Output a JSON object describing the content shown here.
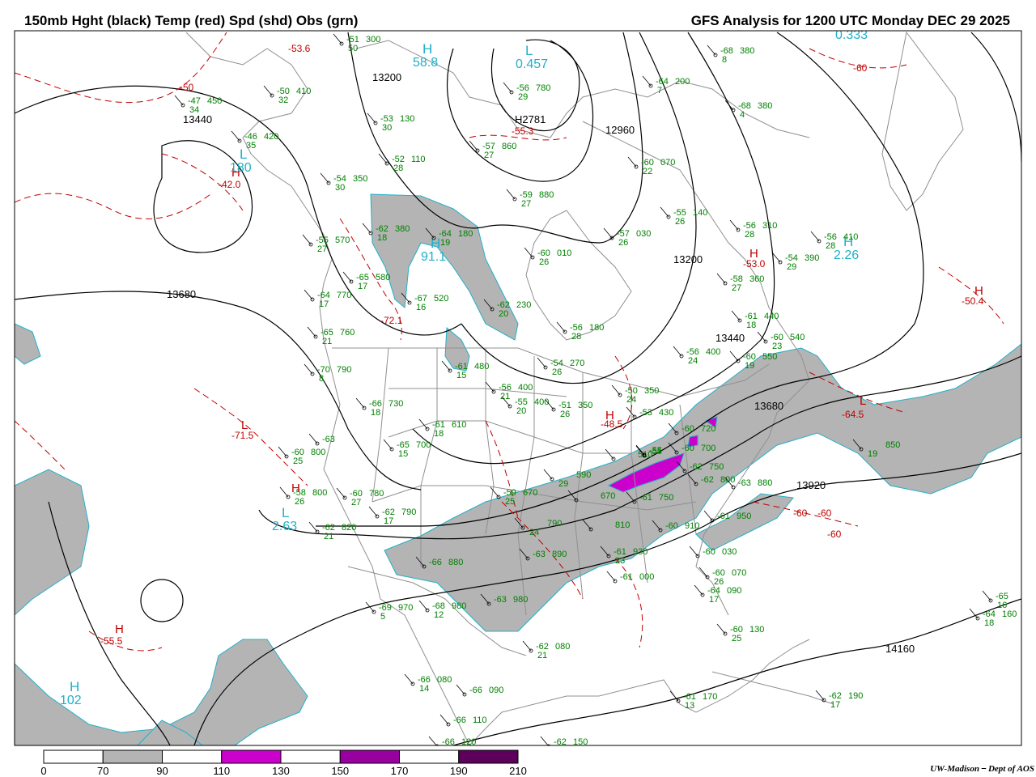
{
  "header": {
    "left_title": "150mb Hght (black) Temp (red) Spd (shd) Obs (grn)",
    "right_title": "GFS Analysis for 1200 UTC Monday  DEC 29 2025"
  },
  "colors": {
    "height": "#000000",
    "temperature": "#c00000",
    "observations": "#008000",
    "speed_70_90": "#b4b4b4",
    "speed_110_130": "#cc00cc",
    "speed_150_170": "#9900a0",
    "speed_190_210": "#5c005c",
    "pressure_centers": "#20b0c8",
    "borders": "#909090"
  },
  "colorbar": {
    "labels": [
      "0",
      "70",
      "90",
      "110",
      "130",
      "150",
      "170",
      "190",
      "210"
    ],
    "segments": [
      {
        "from": 0,
        "to": 70,
        "color": "#ffffff"
      },
      {
        "from": 70,
        "to": 90,
        "color": "#b4b4b4"
      },
      {
        "from": 90,
        "to": 110,
        "color": "#ffffff"
      },
      {
        "from": 110,
        "to": 130,
        "color": "#cc00cc"
      },
      {
        "from": 130,
        "to": 150,
        "color": "#ffffff"
      },
      {
        "from": 150,
        "to": 170,
        "color": "#9900a0"
      },
      {
        "from": 170,
        "to": 190,
        "color": "#ffffff"
      },
      {
        "from": 190,
        "to": 210,
        "color": "#5c005c"
      }
    ]
  },
  "height_labels": [
    "13200",
    "13440",
    "13680",
    "12960",
    "13200",
    "13440",
    "13680",
    "13920",
    "14160",
    "H2781"
  ],
  "temperature_labels": [
    "-53.6",
    "-50",
    "-60",
    "-42.0",
    "-55.3",
    "-72.1",
    "-71.5",
    "-48.5",
    "-60",
    "-53.0",
    "-50.4",
    "-64.5",
    "-60",
    "-60",
    "-55.5"
  ],
  "pressure_centers": [
    {
      "letter": "H",
      "value": "58.8"
    },
    {
      "letter": "L",
      "value": "180"
    },
    {
      "letter": "H",
      "value": "91.1"
    },
    {
      "letter": "L",
      "value": "2.63"
    },
    {
      "letter": "H",
      "value": "102"
    },
    {
      "letter": "H",
      "value": "2.26"
    },
    {
      "letter": "L",
      "value": "0.457"
    },
    {
      "letter": "",
      "value": "0.333"
    }
  ],
  "observations": [
    {
      "temp": "-51",
      "hgt": "300",
      "spd": "50"
    },
    {
      "temp": "-47",
      "hgt": "450",
      "spd": "34"
    },
    {
      "temp": "-50",
      "hgt": "410",
      "spd": "32"
    },
    {
      "temp": "-46",
      "hgt": "420",
      "spd": "35"
    },
    {
      "temp": "-53",
      "hgt": "130",
      "spd": "30"
    },
    {
      "temp": "-57",
      "hgt": "860",
      "spd": "27"
    },
    {
      "temp": "-56",
      "hgt": "780",
      "spd": "29"
    },
    {
      "temp": "-52",
      "hgt": "110",
      "spd": "28"
    },
    {
      "temp": "-54",
      "hgt": "350",
      "spd": "30"
    },
    {
      "temp": "-59",
      "hgt": "880",
      "spd": "27"
    },
    {
      "temp": "-64",
      "hgt": "200",
      "spd": "7"
    },
    {
      "temp": "-68",
      "hgt": "380",
      "spd": "8"
    },
    {
      "temp": "-68",
      "hgt": "380",
      "spd": "4"
    },
    {
      "temp": "-60",
      "hgt": "070",
      "spd": "22"
    },
    {
      "temp": "-55",
      "hgt": "570",
      "spd": "27"
    },
    {
      "temp": "-62",
      "hgt": "380",
      "spd": "18"
    },
    {
      "temp": "-64",
      "hgt": "180",
      "spd": "19"
    },
    {
      "temp": "-60",
      "hgt": "010",
      "spd": "26"
    },
    {
      "temp": "-57",
      "hgt": "030",
      "spd": "26"
    },
    {
      "temp": "-55",
      "hgt": "140",
      "spd": "26"
    },
    {
      "temp": "-56",
      "hgt": "310",
      "spd": "28"
    },
    {
      "temp": "-54",
      "hgt": "390",
      "spd": "29"
    },
    {
      "temp": "-56",
      "hgt": "410",
      "spd": "28"
    },
    {
      "temp": "-65",
      "hgt": "580",
      "spd": "17"
    },
    {
      "temp": "-67",
      "hgt": "520",
      "spd": "16"
    },
    {
      "temp": "-62",
      "hgt": "230",
      "spd": "20"
    },
    {
      "temp": "-58",
      "hgt": "360",
      "spd": "27"
    },
    {
      "temp": "-61",
      "hgt": "440",
      "spd": "18"
    },
    {
      "temp": "-56",
      "hgt": "180",
      "spd": "28"
    },
    {
      "temp": "-65",
      "hgt": "760",
      "spd": "21"
    },
    {
      "temp": "-70",
      "hgt": "790",
      "spd": "8"
    },
    {
      "temp": "-64",
      "hgt": "770",
      "spd": "17"
    },
    {
      "temp": "-60",
      "hgt": "540",
      "spd": "23"
    },
    {
      "temp": "-56",
      "hgt": "400",
      "spd": "24"
    },
    {
      "temp": "-60",
      "hgt": "550",
      "spd": "19"
    },
    {
      "temp": "-61",
      "hgt": "480",
      "spd": "15"
    },
    {
      "temp": "-54",
      "hgt": "270",
      "spd": "26"
    },
    {
      "temp": "-56",
      "hgt": "400",
      "spd": "21"
    },
    {
      "temp": "-55",
      "hgt": "400",
      "spd": "20"
    },
    {
      "temp": "-51",
      "hgt": "350",
      "spd": "26"
    },
    {
      "temp": "-50",
      "hgt": "350",
      "spd": "24"
    },
    {
      "temp": "-53",
      "hgt": "430",
      "spd": ""
    },
    {
      "temp": "-60",
      "hgt": "720",
      "spd": ""
    },
    {
      "temp": "-60",
      "hgt": "700",
      "spd": ""
    },
    {
      "temp": "-66",
      "hgt": "730",
      "spd": "18"
    },
    {
      "temp": "-61",
      "hgt": "610",
      "spd": "18"
    },
    {
      "temp": "-65",
      "hgt": "700",
      "spd": "15"
    },
    {
      "temp": "-63",
      "hgt": "",
      "spd": ""
    },
    {
      "temp": "-60",
      "hgt": "800",
      "spd": "25"
    },
    {
      "temp": "-58",
      "hgt": "800",
      "spd": "26"
    },
    {
      "temp": "-60",
      "hgt": "780",
      "spd": "27"
    },
    {
      "temp": "-62",
      "hgt": "790",
      "spd": "17"
    },
    {
      "temp": "-62",
      "hgt": "820",
      "spd": "21"
    },
    {
      "temp": "-59",
      "hgt": "670",
      "spd": "25"
    },
    {
      "temp": "",
      "hgt": "590",
      "spd": "29"
    },
    {
      "temp": "",
      "hgt": "670",
      "spd": ""
    },
    {
      "temp": "",
      "hgt": "510",
      "spd": ""
    },
    {
      "temp": "-55",
      "hgt": "",
      "spd": ""
    },
    {
      "temp": "-61",
      "hgt": "750",
      "spd": ""
    },
    {
      "temp": "",
      "hgt": "790",
      "spd": "24"
    },
    {
      "temp": "",
      "hgt": "810",
      "spd": ""
    },
    {
      "temp": "-60",
      "hgt": "910",
      "spd": ""
    },
    {
      "temp": "-62",
      "hgt": "750",
      "spd": ""
    },
    {
      "temp": "-62",
      "hgt": "800",
      "spd": ""
    },
    {
      "temp": "-63",
      "hgt": "880",
      "spd": ""
    },
    {
      "temp": "-61",
      "hgt": "950",
      "spd": ""
    },
    {
      "temp": "-63",
      "hgt": "890",
      "spd": ""
    },
    {
      "temp": "-61",
      "hgt": "930",
      "spd": "23"
    },
    {
      "temp": "-60",
      "hgt": "030",
      "spd": ""
    },
    {
      "temp": "-60",
      "hgt": "070",
      "spd": "26"
    },
    {
      "temp": "-61",
      "hgt": "000",
      "spd": ""
    },
    {
      "temp": "-64",
      "hgt": "090",
      "spd": "17"
    },
    {
      "temp": "-66",
      "hgt": "880",
      "spd": ""
    },
    {
      "temp": "-69",
      "hgt": "970",
      "spd": "5"
    },
    {
      "temp": "-68",
      "hgt": "980",
      "spd": "12"
    },
    {
      "temp": "-63",
      "hgt": "980",
      "spd": ""
    },
    {
      "temp": "-62",
      "hgt": "080",
      "spd": "21"
    },
    {
      "temp": "-60",
      "hgt": "130",
      "spd": "25"
    },
    {
      "temp": "-66",
      "hgt": "080",
      "spd": "14"
    },
    {
      "temp": "-66",
      "hgt": "090",
      "spd": ""
    },
    {
      "temp": "-66",
      "hgt": "110",
      "spd": ""
    },
    {
      "temp": "-66",
      "hgt": "120",
      "spd": ""
    },
    {
      "temp": "-62",
      "hgt": "150",
      "spd": ""
    },
    {
      "temp": "-61",
      "hgt": "170",
      "spd": "13"
    },
    {
      "temp": "-62",
      "hgt": "190",
      "spd": "17"
    },
    {
      "temp": "-64",
      "hgt": "160",
      "spd": "18"
    },
    {
      "temp": "-65",
      "hgt": "",
      "spd": "16"
    },
    {
      "temp": "",
      "hgt": "850",
      "spd": "19"
    },
    {
      "temp": "-55",
      "hgt": "",
      "spd": ""
    }
  ],
  "credit": {
    "org": "UW-Madison",
    "dept": "Dept of AOS"
  }
}
